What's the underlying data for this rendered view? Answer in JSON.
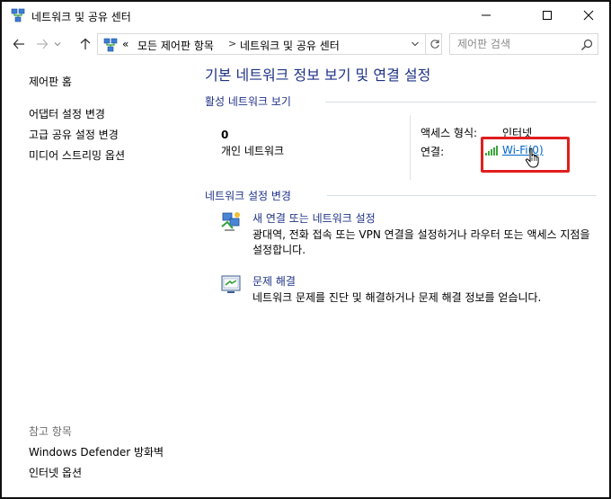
{
  "window": {
    "title": "네트워크 및 공유 센터"
  },
  "address_bar": {
    "overflow": "«",
    "crumbs": [
      "모든 제어판 항목",
      "네트워크 및 공유 센터"
    ]
  },
  "search": {
    "placeholder": "제어판 검색"
  },
  "sidebar": {
    "home": "제어판 홈",
    "links": [
      "어댑터 설정 변경",
      "고급 공유 설정 변경",
      "미디어 스트리밍 옵션"
    ],
    "see_also_title": "참고 항목",
    "see_also": [
      "Windows Defender 방화벽",
      "인터넷 옵션"
    ]
  },
  "main": {
    "title": "기본 네트워크 정보 보기 및 연결 설정",
    "active_networks_title": "활성 네트워크 보기",
    "network": {
      "name": "0",
      "type": "개인 네트워크",
      "access_type_label": "액세스 형식:",
      "access_type_value": "인터넷",
      "connection_label": "연결:",
      "connection_value": "Wi-Fi(0)"
    },
    "change_settings_title": "네트워크 설정 변경",
    "tasks": [
      {
        "label": "새 연결 또는 네트워크 설정",
        "desc": "광대역, 전화 접속 또는 VPN 연결을 설정하거나 라우터 또는 액세스 지점을 설정합니다."
      },
      {
        "label": "문제 해결",
        "desc": "네트워크 문제를 진단 및 해결하거나 문제 해결 정보를 얻습니다."
      }
    ]
  },
  "colors": {
    "heading_blue": "#1e3287",
    "link_blue": "#0066cc",
    "highlight_red": "#e01e1e"
  }
}
